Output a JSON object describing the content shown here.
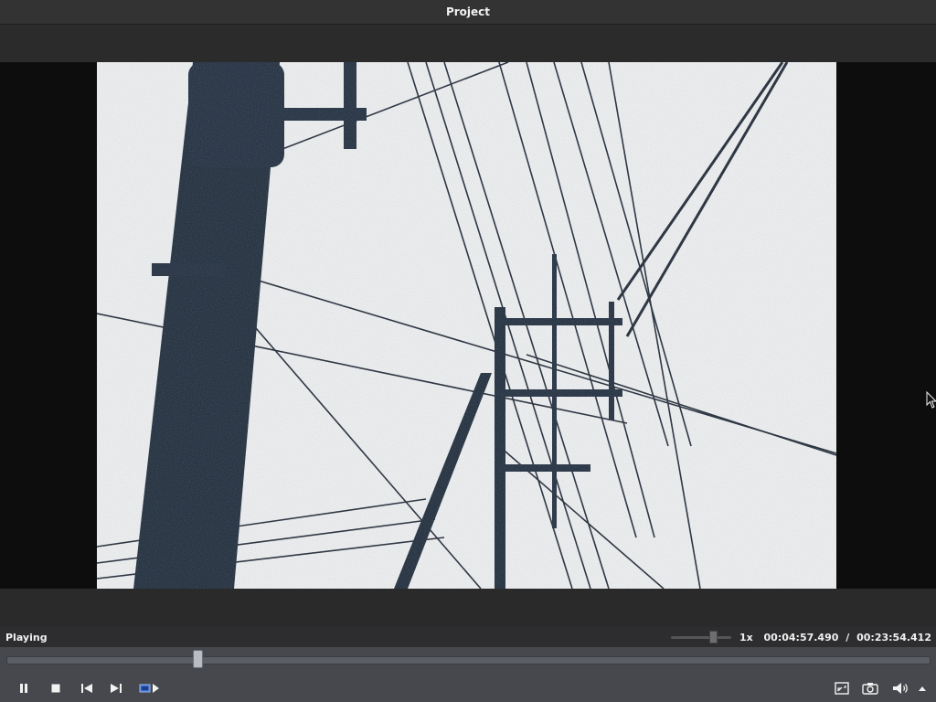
{
  "window": {
    "title": "Project"
  },
  "player": {
    "status": "Playing",
    "speed": "1x",
    "speed_level": 0.7,
    "current_time": "00:04:57.490",
    "separator": "/",
    "total_time": "00:23:54.412",
    "progress": 0.207
  },
  "controls": {
    "left": [
      "pause-icon",
      "stop-icon",
      "previous-frame-icon",
      "next-frame-icon",
      "playlist-icon"
    ],
    "right": [
      "fullscreen-icon",
      "snapshot-icon",
      "volume-icon",
      "menu-up-icon"
    ]
  },
  "colors": {
    "title_bar": "#333333",
    "controls_bg": "#46484d",
    "video_bg": "#eef0f2"
  }
}
